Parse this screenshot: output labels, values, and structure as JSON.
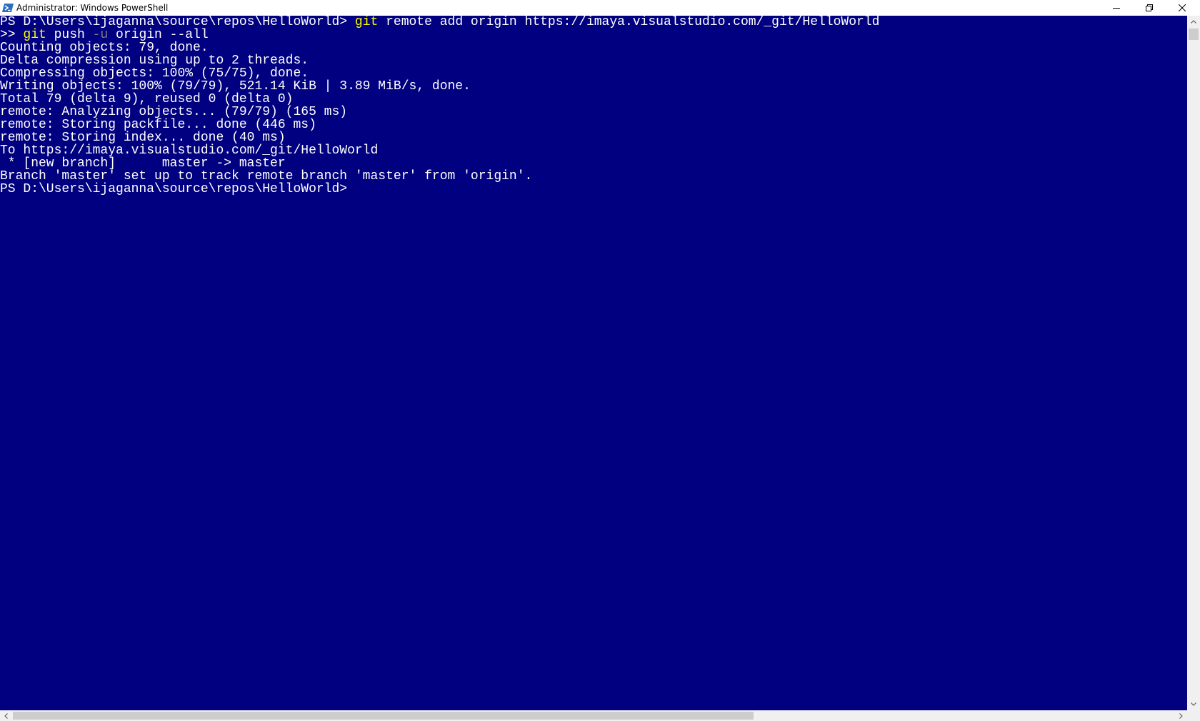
{
  "window": {
    "title": "Administrator: Windows PowerShell",
    "icon": "powershell-icon",
    "controls": [
      "minimize-icon",
      "restore-icon",
      "close-icon"
    ]
  },
  "colors": {
    "console_bg": "#000080",
    "text": "#FFFFFF",
    "command": "#FFFF00",
    "parameter": "#808080"
  },
  "console": {
    "lines": [
      {
        "segments": [
          {
            "text": "PS D:\\Users\\ijaganna\\source\\repos\\HelloWorld> ",
            "style": "normal"
          },
          {
            "text": "git",
            "style": "command"
          },
          {
            "text": " remote add origin https://imaya.visualstudio.com/_git/HelloWorld",
            "style": "normal"
          }
        ]
      },
      {
        "segments": [
          {
            "text": ">> ",
            "style": "normal"
          },
          {
            "text": "git",
            "style": "command"
          },
          {
            "text": " push ",
            "style": "normal"
          },
          {
            "text": "-u",
            "style": "parameter"
          },
          {
            "text": " origin --all",
            "style": "normal"
          }
        ]
      },
      {
        "segments": [
          {
            "text": "Counting objects: 79, done.",
            "style": "normal"
          }
        ]
      },
      {
        "segments": [
          {
            "text": "Delta compression using up to 2 threads.",
            "style": "normal"
          }
        ]
      },
      {
        "segments": [
          {
            "text": "Compressing objects: 100% (75/75), done.",
            "style": "normal"
          }
        ]
      },
      {
        "segments": [
          {
            "text": "Writing objects: 100% (79/79), 521.14 KiB | 3.89 MiB/s, done.",
            "style": "normal"
          }
        ]
      },
      {
        "segments": [
          {
            "text": "Total 79 (delta 9), reused 0 (delta 0)",
            "style": "normal"
          }
        ]
      },
      {
        "segments": [
          {
            "text": "remote: Analyzing objects... (79/79) (165 ms)",
            "style": "normal"
          }
        ]
      },
      {
        "segments": [
          {
            "text": "remote: Storing packfile... done (446 ms)",
            "style": "normal"
          }
        ]
      },
      {
        "segments": [
          {
            "text": "remote: Storing index... done (40 ms)",
            "style": "normal"
          }
        ]
      },
      {
        "segments": [
          {
            "text": "To https://imaya.visualstudio.com/_git/HelloWorld",
            "style": "normal"
          }
        ]
      },
      {
        "segments": [
          {
            "text": " * [new branch]      master -> master",
            "style": "normal"
          }
        ]
      },
      {
        "segments": [
          {
            "text": "Branch 'master' set up to track remote branch 'master' from 'origin'.",
            "style": "normal"
          }
        ]
      },
      {
        "segments": [
          {
            "text": "PS D:\\Users\\ijaganna\\source\\repos\\HelloWorld>",
            "style": "normal"
          }
        ]
      }
    ]
  }
}
